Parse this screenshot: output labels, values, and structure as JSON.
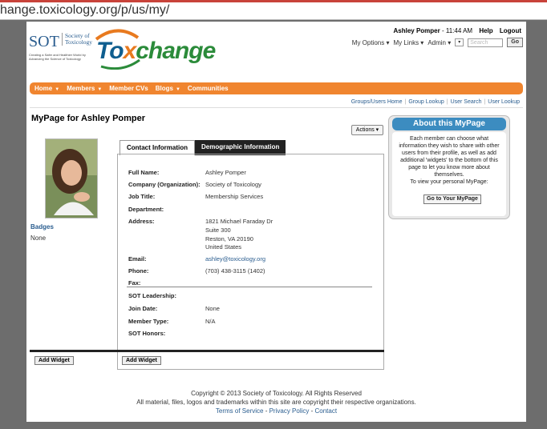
{
  "browser": {
    "url": "hange.toxicology.org/p/us/my/"
  },
  "header": {
    "sot_logo": {
      "short": "SOT",
      "name_line1": "Society of",
      "name_line2": "Toxicology",
      "tagline": "Creating a Safer and Healthier World by Advancing the Science of Toxicology"
    },
    "tox_logo": {
      "part1": "To",
      "part2": "x",
      "part3": "change"
    },
    "user": "Ashley Pomper",
    "time": "- 11:44 AM",
    "help": "Help",
    "logout": "Logout",
    "my_options": "My Options",
    "my_links": "My Links",
    "admin": "Admin",
    "select_marker": "▾",
    "search_placeholder": "Search",
    "go": "Go"
  },
  "nav": {
    "items": [
      "Home",
      "Members",
      "Member CVs",
      "Blogs",
      "Communities"
    ]
  },
  "sublinks": [
    "Groups/Users Home",
    "Group Lookup",
    "User Search",
    "User Lookup"
  ],
  "page": {
    "title": "MyPage for Ashley Pomper",
    "actions": "Actions ▾",
    "badges_label": "Badges",
    "badges_value": "None",
    "add_widget": "Add Widget"
  },
  "tabs": [
    "Contact Information",
    "Demographic Information"
  ],
  "contact": {
    "full_name_label": "Full Name:",
    "full_name": "Ashley Pomper",
    "company_label": "Company (Organization):",
    "company": "Society of Toxicology",
    "job_label": "Job Title:",
    "job": "Membership Services",
    "dept_label": "Department:",
    "address_label": "Address:",
    "address1": "1821 Michael Faraday Dr",
    "address2": "Suite 300",
    "address3": "Reston, VA 20190",
    "address4": "United States",
    "email_label": "Email:",
    "email": "ashley@toxicology.org",
    "phone_label": "Phone:",
    "phone": "(703) 438-3115 (1402)",
    "fax_label": "Fax:",
    "leadership_label": "SOT Leadership:",
    "join_label": "Join Date:",
    "join": "None",
    "member_type_label": "Member Type:",
    "member_type": "N/A",
    "honors_label": "SOT Honors:"
  },
  "about": {
    "title": "About this MyPage",
    "body": "Each member can choose what information they wish to share with other users from their profile, as well as add additional 'widgets' to the bottom of this page to let you know more about themselves.",
    "cta_text": "To view your personal MyPage:",
    "button": "Go to Your MyPage"
  },
  "footer": {
    "copyright": "Copyright © 2013 Society of Toxicology. All Rights Reserved",
    "notice": "All material, files, logos and trademarks within this site are copyright their respective organizations.",
    "links": [
      "Terms of Service",
      "Privacy Policy",
      "Contact"
    ]
  }
}
